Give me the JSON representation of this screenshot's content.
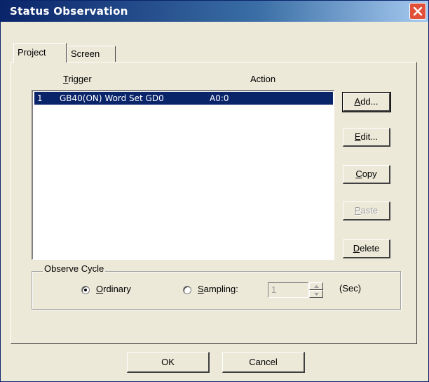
{
  "window": {
    "title": "Status Observation"
  },
  "tabs": [
    {
      "label": "Project",
      "active": true
    },
    {
      "label": "Screen",
      "active": false
    }
  ],
  "list": {
    "headers": {
      "trigger": "Trigger",
      "action": "Action"
    },
    "rows": [
      {
        "number": "1",
        "trigger": "GB40(ON) Word Set GD0",
        "action": "A0:0",
        "selected": true
      }
    ]
  },
  "buttons": {
    "add": "Add...",
    "edit": "Edit...",
    "copy": "Copy",
    "paste": "Paste",
    "delete": "Delete",
    "ok": "OK",
    "cancel": "Cancel"
  },
  "observe_cycle": {
    "legend": "Observe Cycle",
    "ordinary_label": "Ordinary",
    "sampling_label": "Sampling:",
    "selected": "Ordinary",
    "sampling_value": "1",
    "unit": "(Sec)"
  },
  "icons": {
    "close": "close-icon",
    "spin_up": "arrow-up-icon",
    "spin_down": "arrow-down-icon"
  },
  "colors": {
    "titlebar": "#0a246a",
    "selection": "#0a246a",
    "close": "#e0503a"
  }
}
